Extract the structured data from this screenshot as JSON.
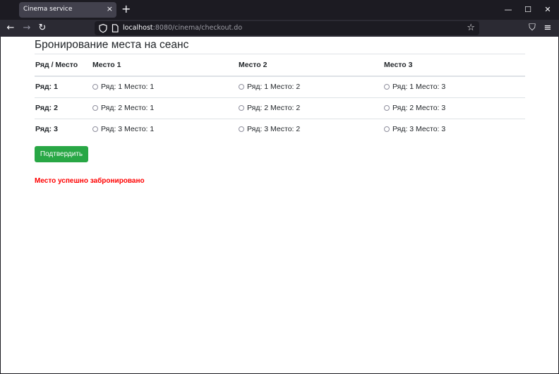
{
  "browser": {
    "tab_title": "Cinema service",
    "tab_close": "×",
    "new_tab": "+",
    "url_host": "localhost",
    "url_path": ":8080/cinema/checkout.do",
    "window": {
      "minimize": "—",
      "maximize": "☐",
      "close": "✕"
    },
    "nav": {
      "back": "←",
      "forward": "→",
      "reload": "↻",
      "bookmark": "☆",
      "pocket": "⛉",
      "menu": "≡"
    }
  },
  "page": {
    "title": "Бронирование места на сеанс",
    "table": {
      "headers": [
        "Ряд / Место",
        "Место 1",
        "Место 2",
        "Место 3"
      ],
      "rows": [
        {
          "label": "Ряд: 1",
          "seats": [
            "Ряд: 1 Место: 1",
            "Ряд: 1 Место: 2",
            "Ряд: 1 Место: 3"
          ]
        },
        {
          "label": "Ряд: 2",
          "seats": [
            "Ряд: 2 Место: 1",
            "Ряд: 2 Место: 2",
            "Ряд: 2 Место: 3"
          ]
        },
        {
          "label": "Ряд: 3",
          "seats": [
            "Ряд: 3 Место: 1",
            "Ряд: 3 Место: 2",
            "Ряд: 3 Место: 3"
          ]
        }
      ]
    },
    "confirm_label": "Подтвердить",
    "success_message": "Место успешно забронировано"
  },
  "colors": {
    "accent_button": "#28a745",
    "message": "#ff0000",
    "chrome_dark": "#1c1b22"
  }
}
